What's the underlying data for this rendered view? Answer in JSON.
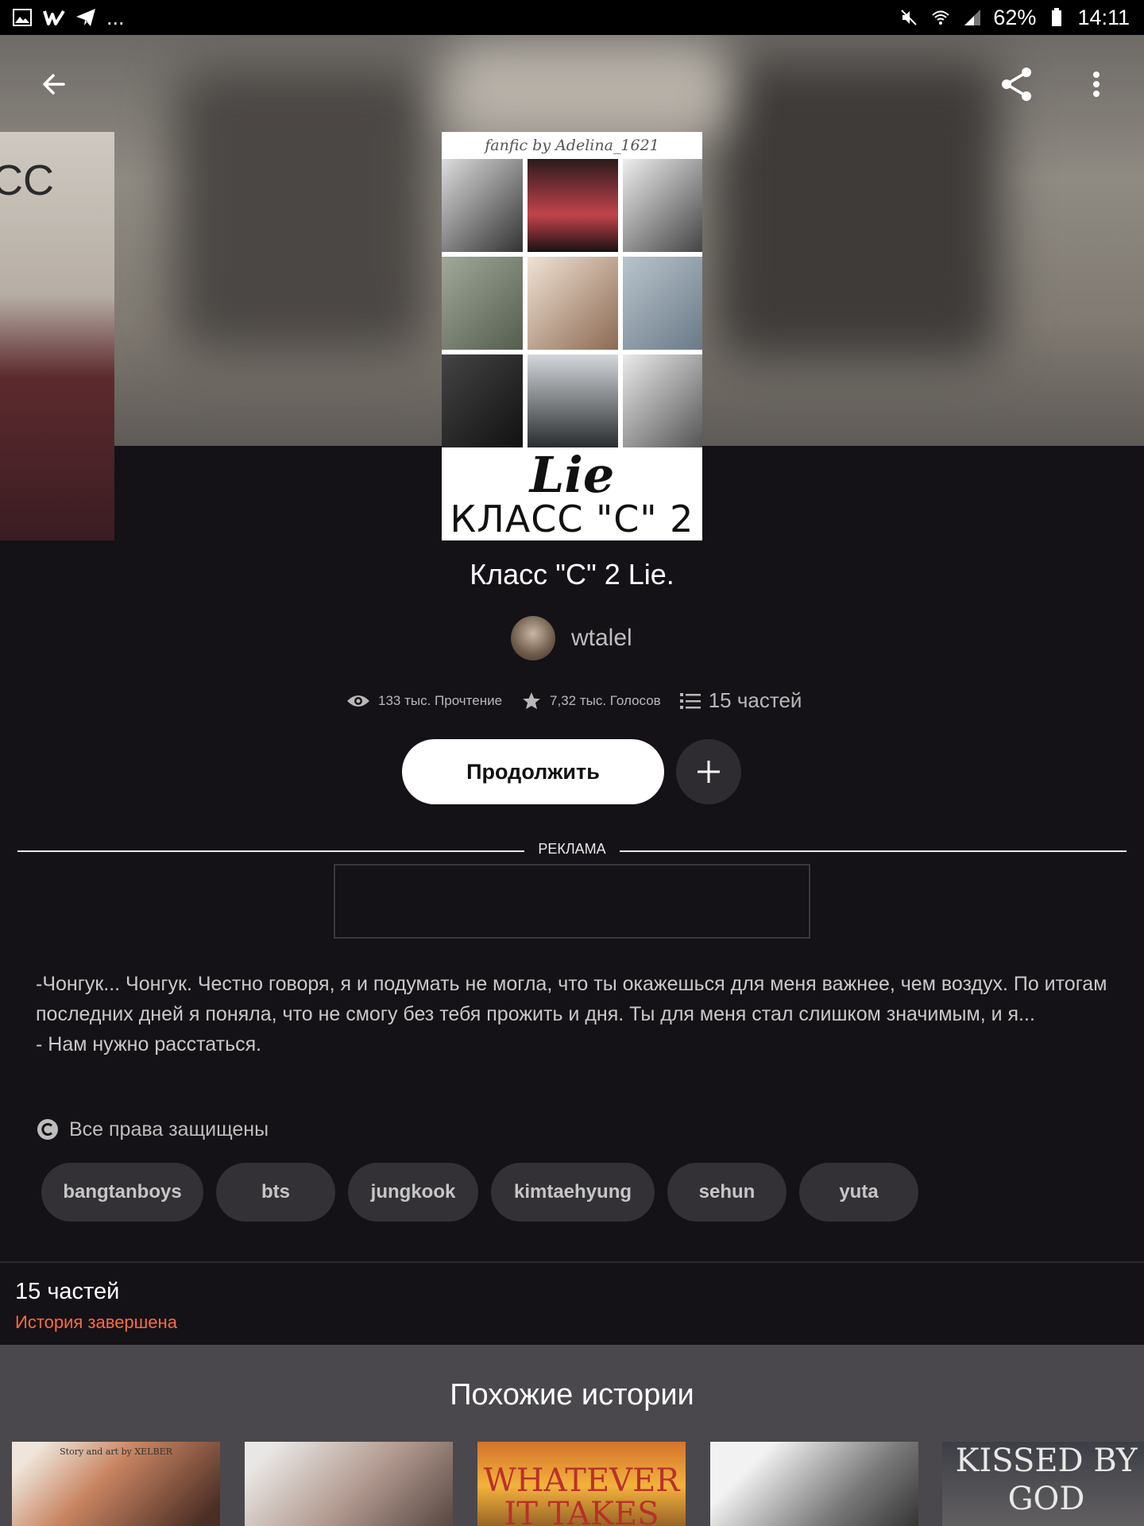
{
  "status_bar": {
    "notification_dots": "...",
    "battery": "62%",
    "time": "14:11"
  },
  "header": {
    "back_icon": "arrow-left-icon",
    "share_icon": "share-icon",
    "more_icon": "more-vertical-icon"
  },
  "cover": {
    "signature": "fanfic by Adelina_1621",
    "title_line1": "Lie",
    "title_line2": "КЛАСС \"C\" 2"
  },
  "side_cover": {
    "text": "CC"
  },
  "story": {
    "title": "Класс \"C\" 2 Lie.",
    "author": "wtalel"
  },
  "stats": {
    "reads": "133 тыс. Прочтение",
    "votes": "7,32 тыс. Голосов",
    "parts": "15 частей"
  },
  "actions": {
    "continue_label": "Продолжить",
    "add_icon": "plus-icon"
  },
  "ad": {
    "label": "РЕКЛАМА"
  },
  "description": "-Чонгук... Чонгук. Честно говоря, я и подумать не могла, что ты окажешься для меня важнее, чем воздух. По итогам последних дней я поняла, что не смогу без тебя прожить и дня. Ты для меня стал слишком значимым, и я...\n  - Нам нужно расстаться.",
  "copyright": "Все права защищены",
  "tags": [
    "bangtanboys",
    "bts",
    "jungkook",
    "kimtaehyung",
    "sehun",
    "yuta"
  ],
  "parts_section": {
    "count": "15 частей",
    "status": "История завершена"
  },
  "similar": {
    "title": "Похожие истории",
    "covers": [
      {
        "text": "Story and art by XELBER"
      },
      {
        "text": ""
      },
      {
        "text": "WHATEVER IT TAKES"
      },
      {
        "text": ""
      },
      {
        "text": "KISSED BY GOD"
      }
    ]
  },
  "colors": {
    "background": "#141216",
    "accent_status": "#ff6a3d",
    "tag_bg": "#333136",
    "similar_bg": "#4a484c"
  }
}
